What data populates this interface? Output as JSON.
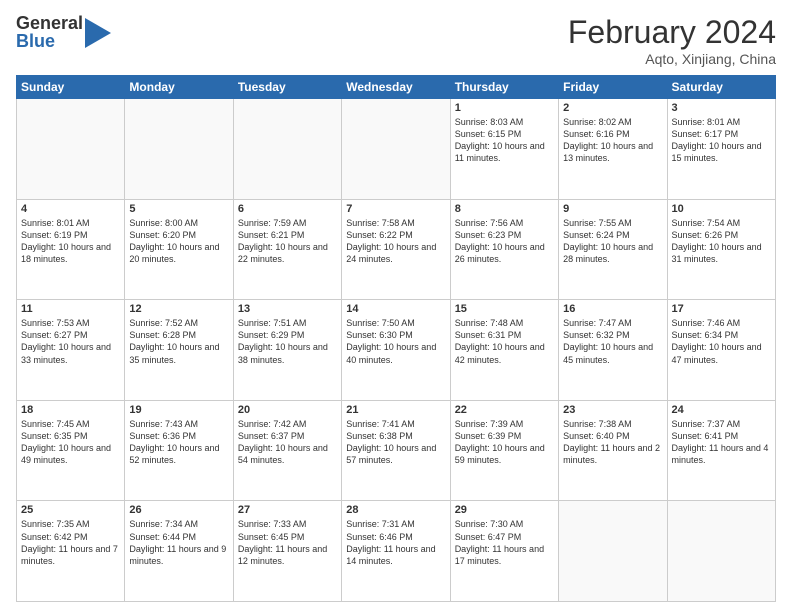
{
  "header": {
    "logo_general": "General",
    "logo_blue": "Blue",
    "title": "February 2024",
    "location": "Aqto, Xinjiang, China"
  },
  "days_of_week": [
    "Sunday",
    "Monday",
    "Tuesday",
    "Wednesday",
    "Thursday",
    "Friday",
    "Saturday"
  ],
  "weeks": [
    [
      {
        "day": "",
        "info": ""
      },
      {
        "day": "",
        "info": ""
      },
      {
        "day": "",
        "info": ""
      },
      {
        "day": "",
        "info": ""
      },
      {
        "day": "1",
        "info": "Sunrise: 8:03 AM\nSunset: 6:15 PM\nDaylight: 10 hours\nand 11 minutes."
      },
      {
        "day": "2",
        "info": "Sunrise: 8:02 AM\nSunset: 6:16 PM\nDaylight: 10 hours\nand 13 minutes."
      },
      {
        "day": "3",
        "info": "Sunrise: 8:01 AM\nSunset: 6:17 PM\nDaylight: 10 hours\nand 15 minutes."
      }
    ],
    [
      {
        "day": "4",
        "info": "Sunrise: 8:01 AM\nSunset: 6:19 PM\nDaylight: 10 hours\nand 18 minutes."
      },
      {
        "day": "5",
        "info": "Sunrise: 8:00 AM\nSunset: 6:20 PM\nDaylight: 10 hours\nand 20 minutes."
      },
      {
        "day": "6",
        "info": "Sunrise: 7:59 AM\nSunset: 6:21 PM\nDaylight: 10 hours\nand 22 minutes."
      },
      {
        "day": "7",
        "info": "Sunrise: 7:58 AM\nSunset: 6:22 PM\nDaylight: 10 hours\nand 24 minutes."
      },
      {
        "day": "8",
        "info": "Sunrise: 7:56 AM\nSunset: 6:23 PM\nDaylight: 10 hours\nand 26 minutes."
      },
      {
        "day": "9",
        "info": "Sunrise: 7:55 AM\nSunset: 6:24 PM\nDaylight: 10 hours\nand 28 minutes."
      },
      {
        "day": "10",
        "info": "Sunrise: 7:54 AM\nSunset: 6:26 PM\nDaylight: 10 hours\nand 31 minutes."
      }
    ],
    [
      {
        "day": "11",
        "info": "Sunrise: 7:53 AM\nSunset: 6:27 PM\nDaylight: 10 hours\nand 33 minutes."
      },
      {
        "day": "12",
        "info": "Sunrise: 7:52 AM\nSunset: 6:28 PM\nDaylight: 10 hours\nand 35 minutes."
      },
      {
        "day": "13",
        "info": "Sunrise: 7:51 AM\nSunset: 6:29 PM\nDaylight: 10 hours\nand 38 minutes."
      },
      {
        "day": "14",
        "info": "Sunrise: 7:50 AM\nSunset: 6:30 PM\nDaylight: 10 hours\nand 40 minutes."
      },
      {
        "day": "15",
        "info": "Sunrise: 7:48 AM\nSunset: 6:31 PM\nDaylight: 10 hours\nand 42 minutes."
      },
      {
        "day": "16",
        "info": "Sunrise: 7:47 AM\nSunset: 6:32 PM\nDaylight: 10 hours\nand 45 minutes."
      },
      {
        "day": "17",
        "info": "Sunrise: 7:46 AM\nSunset: 6:34 PM\nDaylight: 10 hours\nand 47 minutes."
      }
    ],
    [
      {
        "day": "18",
        "info": "Sunrise: 7:45 AM\nSunset: 6:35 PM\nDaylight: 10 hours\nand 49 minutes."
      },
      {
        "day": "19",
        "info": "Sunrise: 7:43 AM\nSunset: 6:36 PM\nDaylight: 10 hours\nand 52 minutes."
      },
      {
        "day": "20",
        "info": "Sunrise: 7:42 AM\nSunset: 6:37 PM\nDaylight: 10 hours\nand 54 minutes."
      },
      {
        "day": "21",
        "info": "Sunrise: 7:41 AM\nSunset: 6:38 PM\nDaylight: 10 hours\nand 57 minutes."
      },
      {
        "day": "22",
        "info": "Sunrise: 7:39 AM\nSunset: 6:39 PM\nDaylight: 10 hours\nand 59 minutes."
      },
      {
        "day": "23",
        "info": "Sunrise: 7:38 AM\nSunset: 6:40 PM\nDaylight: 11 hours\nand 2 minutes."
      },
      {
        "day": "24",
        "info": "Sunrise: 7:37 AM\nSunset: 6:41 PM\nDaylight: 11 hours\nand 4 minutes."
      }
    ],
    [
      {
        "day": "25",
        "info": "Sunrise: 7:35 AM\nSunset: 6:42 PM\nDaylight: 11 hours\nand 7 minutes."
      },
      {
        "day": "26",
        "info": "Sunrise: 7:34 AM\nSunset: 6:44 PM\nDaylight: 11 hours\nand 9 minutes."
      },
      {
        "day": "27",
        "info": "Sunrise: 7:33 AM\nSunset: 6:45 PM\nDaylight: 11 hours\nand 12 minutes."
      },
      {
        "day": "28",
        "info": "Sunrise: 7:31 AM\nSunset: 6:46 PM\nDaylight: 11 hours\nand 14 minutes."
      },
      {
        "day": "29",
        "info": "Sunrise: 7:30 AM\nSunset: 6:47 PM\nDaylight: 11 hours\nand 17 minutes."
      },
      {
        "day": "",
        "info": ""
      },
      {
        "day": "",
        "info": ""
      }
    ]
  ]
}
